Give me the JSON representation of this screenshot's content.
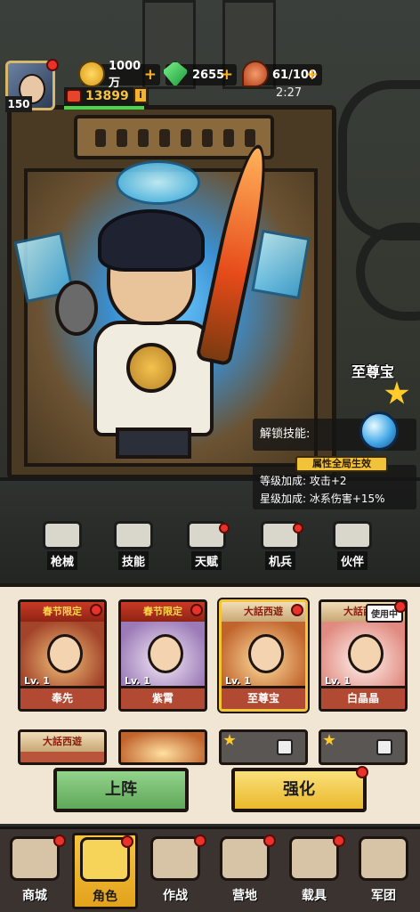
{
  "player": {
    "level": "150"
  },
  "resources": {
    "gold": "1000万",
    "gems": "2655",
    "stamina": "61/100"
  },
  "power": "13899",
  "info_icon": "i",
  "clock": "2:27",
  "hero": {
    "name": "至尊宝",
    "stars": 1,
    "unlock_label": "解锁技能:",
    "global_tag": "属性全局生效",
    "level_bonus": "等级加成: 攻击+2",
    "star_bonus": "星级加成: 冰系伤害+15%"
  },
  "subnav": [
    {
      "label": "枪械",
      "icon": "gun-icon"
    },
    {
      "label": "技能",
      "icon": "skill-icon"
    },
    {
      "label": "天赋",
      "icon": "talent-icon"
    },
    {
      "label": "机兵",
      "icon": "mech-icon"
    },
    {
      "label": "伙伴",
      "icon": "partner-icon"
    }
  ],
  "roster": [
    {
      "banner": "春节限定",
      "lv": "Lv. 1",
      "name": "奉先"
    },
    {
      "banner": "春节限定",
      "lv": "Lv. 1",
      "name": "紫霄"
    },
    {
      "banner": "大話西遊",
      "lv": "Lv. 1",
      "name": "至尊宝"
    },
    {
      "banner": "大話西遊",
      "lv": "Lv. 1",
      "name": "白晶晶",
      "badge": "使用中"
    },
    {
      "banner": "大話西遊"
    }
  ],
  "buttons": {
    "deploy": "上阵",
    "upgrade": "强化"
  },
  "bottomnav": [
    {
      "label": "商城",
      "icon": "shop-cart-icon"
    },
    {
      "label": "角色",
      "icon": "character-icon"
    },
    {
      "label": "作战",
      "icon": "battle-icon"
    },
    {
      "label": "营地",
      "icon": "camp-icon"
    },
    {
      "label": "载具",
      "icon": "vehicle-icon"
    },
    {
      "label": "军团",
      "icon": "legion-icon"
    }
  ],
  "colors": {
    "accent_gold": "#f2c23a",
    "button_green": "#93d38b",
    "button_yellow": "#fbe07a",
    "notify_red": "#e8322a"
  }
}
